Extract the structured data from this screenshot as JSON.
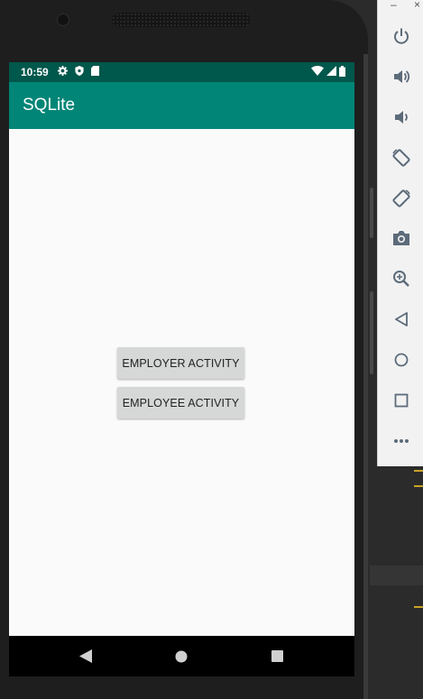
{
  "status_bar": {
    "time": "10:59",
    "icons_left": [
      "gear-icon",
      "shield-icon",
      "sd-card-icon"
    ],
    "icons_right": [
      "wifi-icon",
      "signal-icon",
      "battery-icon"
    ]
  },
  "app_bar": {
    "title": "SQLite"
  },
  "buttons": {
    "employer_label": "EMPLOYER ACTIVITY",
    "employee_label": "EMPLOYEE ACTIVITY"
  },
  "nav_bar": {
    "items": [
      "back-icon",
      "home-icon",
      "recents-icon"
    ]
  },
  "emulator_toolbar": {
    "window_controls": [
      "minimize-icon",
      "close-icon"
    ],
    "items": [
      "power-icon",
      "volume-up-icon",
      "volume-down-icon",
      "rotate-left-icon",
      "rotate-right-icon",
      "camera-icon",
      "zoom-icon",
      "back-icon",
      "home-icon",
      "overview-icon",
      "more-icon"
    ]
  },
  "colors": {
    "status_bar": "#00574b",
    "app_bar": "#008577",
    "button": "#d6d7d7",
    "background": "#fafafa"
  }
}
